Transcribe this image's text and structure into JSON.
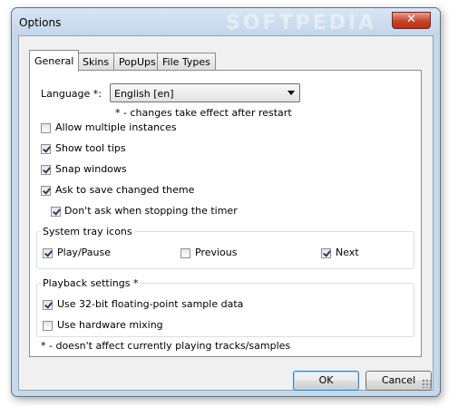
{
  "window": {
    "title": "Options",
    "watermark": "SOFTPEDIA",
    "close_label": "✕"
  },
  "tabs": [
    {
      "label": "General",
      "active": true
    },
    {
      "label": "Skins",
      "active": false
    },
    {
      "label": "PopUps",
      "active": false
    },
    {
      "label": "File Types",
      "active": false
    }
  ],
  "general": {
    "language_label": "Language *:",
    "language_value": "English [en]",
    "restart_note": "* - changes take effect after restart",
    "options": [
      {
        "label": "Allow multiple instances",
        "checked": false
      },
      {
        "label": "Show tool tips",
        "checked": true
      },
      {
        "label": "Snap windows",
        "checked": true
      },
      {
        "label": "Ask to save changed theme",
        "checked": true
      },
      {
        "label": "Don't ask when stopping the timer",
        "checked": true
      }
    ],
    "tray": {
      "title": "System tray icons",
      "items": [
        {
          "label": "Play/Pause",
          "checked": true
        },
        {
          "label": "Previous",
          "checked": false
        },
        {
          "label": "Next",
          "checked": true
        }
      ]
    },
    "playback": {
      "title": "Playback settings *",
      "items": [
        {
          "label": "Use 32-bit floating-point sample data",
          "checked": true
        },
        {
          "label": "Use hardware mixing",
          "checked": false
        }
      ]
    },
    "footer_note": "* - doesn't affect currently playing tracks/samples"
  },
  "buttons": {
    "ok": "OK",
    "cancel": "Cancel"
  }
}
